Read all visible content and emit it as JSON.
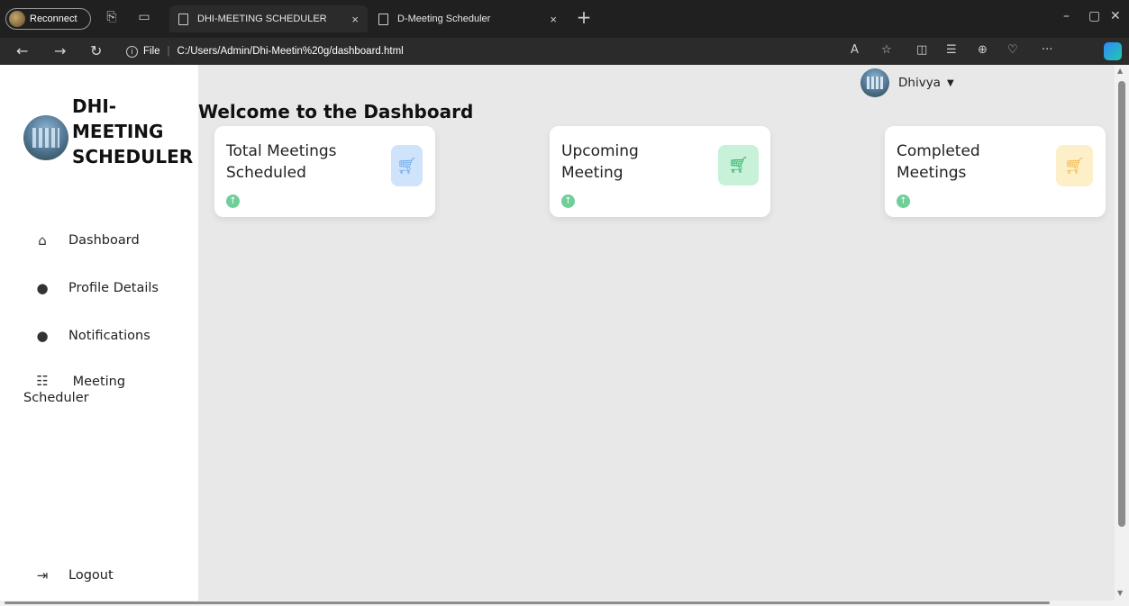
{
  "browser": {
    "reconnect_label": "Reconnect",
    "tabs": [
      {
        "title": "DHI-MEETING SCHEDULER",
        "close": "×"
      },
      {
        "title": "D-Meeting Scheduler",
        "close": "×"
      }
    ],
    "new_tab": "+",
    "url_prefix": "File",
    "url": "C:/Users/Admin/Dhi-Meetin%20g/dashboard.html",
    "window": {
      "minimize": "–",
      "restore": "▢",
      "close": "✕"
    }
  },
  "sidebar": {
    "brand": "DHI-\nMEETING\nSCHEDULER",
    "brand_lines": [
      "DHI-",
      "MEETING",
      "SCHEDULER"
    ],
    "items": [
      {
        "label": "Dashboard",
        "icon": "home-icon"
      },
      {
        "label": "Profile Details",
        "icon": "user-icon"
      },
      {
        "label": "Notifications",
        "icon": "user-icon"
      },
      {
        "label_line1": "Meeting",
        "label_line2": "Scheduler",
        "icon": "list-icon"
      }
    ],
    "logout_label": "Logout",
    "logout_icon": "sign-out-icon"
  },
  "header": {
    "user_name": "Dhivya",
    "welcome": "Welcome to the Dashboard"
  },
  "cards": [
    {
      "label_line1": "Total Meetings",
      "label_line2": "Scheduled",
      "badge_color": "#cfe3fb",
      "icon_color": "#6aa7ea"
    },
    {
      "label_line1": "Upcoming",
      "label_line2": "Meeting",
      "badge_color": "#c7f1d9",
      "icon_color": "#27ae60"
    },
    {
      "label_line1": "Completed",
      "label_line2": "Meetings",
      "badge_color": "#fdefc8",
      "icon_color": "#f2b84b"
    }
  ]
}
